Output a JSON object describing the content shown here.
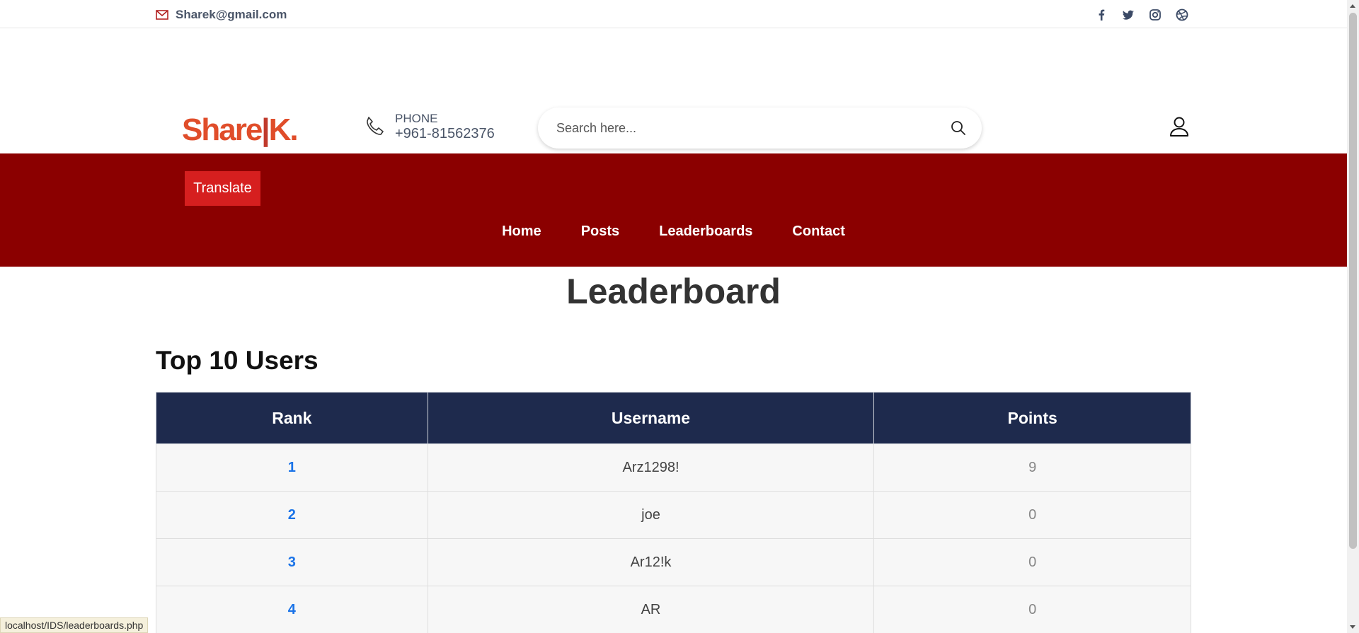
{
  "topbar": {
    "email": "Sharek@gmail.com",
    "social_icons": [
      "facebook-icon",
      "twitter-icon",
      "instagram-icon",
      "dribbble-icon"
    ]
  },
  "header": {
    "logo_left": "Share",
    "logo_bar": "|",
    "logo_right": "K.",
    "phone_label": "PHONE",
    "phone_number": "+961-81562376",
    "search_placeholder": "Search here..."
  },
  "navband": {
    "translate_label": "Translate",
    "nav": {
      "home": "Home",
      "posts": "Posts",
      "leaderboards": "Leaderboards",
      "contact": "Contact"
    }
  },
  "main": {
    "page_title": "Leaderboard",
    "section_title": "Top 10 Users",
    "table": {
      "headers": [
        "Rank",
        "Username",
        "Points"
      ],
      "rows": [
        {
          "rank": "1",
          "username": "Arz1298!",
          "points": "9"
        },
        {
          "rank": "2",
          "username": "joe",
          "points": "0"
        },
        {
          "rank": "3",
          "username": "Ar12!k",
          "points": "0"
        },
        {
          "rank": "4",
          "username": "AR",
          "points": "0"
        }
      ]
    }
  },
  "status_bar": {
    "url": "localhost/IDS/leaderboards.php"
  },
  "colors": {
    "brand_red": "#8b0000",
    "translate_red": "#d61f1f",
    "table_header": "#1e2a4d",
    "rank_link": "#1a73e8",
    "logo": "#e04d2a"
  }
}
